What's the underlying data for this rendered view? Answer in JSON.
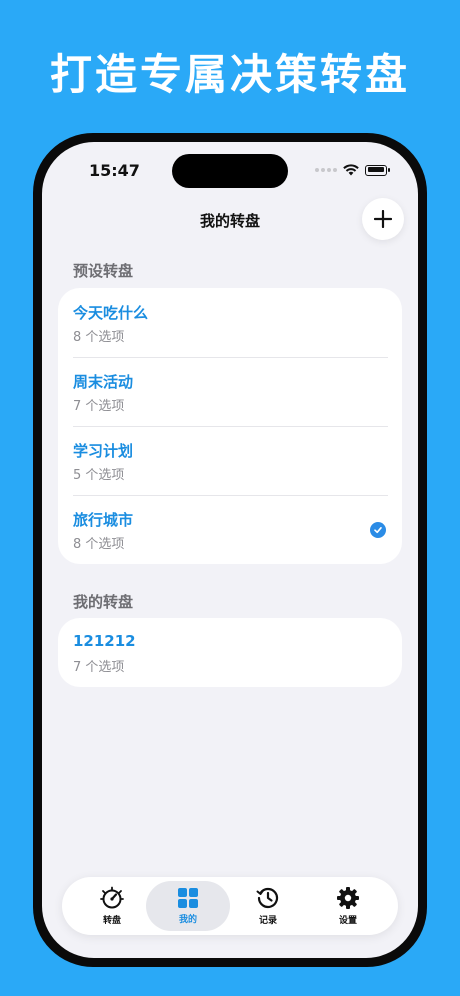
{
  "headline": "打造专属决策转盘",
  "status_bar": {
    "time": "15:47"
  },
  "nav": {
    "title": "我的转盘",
    "add_icon": "plus-icon"
  },
  "preset_section": {
    "title": "预设转盘",
    "items": [
      {
        "name": "今天吃什么",
        "subtitle": "8 个选项",
        "selected": false
      },
      {
        "name": "周末活动",
        "subtitle": "7 个选项",
        "selected": false
      },
      {
        "name": "学习计划",
        "subtitle": "5 个选项",
        "selected": false
      },
      {
        "name": "旅行城市",
        "subtitle": "8 个选项",
        "selected": true
      }
    ]
  },
  "my_section": {
    "title": "我的转盘",
    "items": [
      {
        "name": "121212",
        "subtitle": "7 个选项"
      }
    ]
  },
  "tabbar": {
    "tabs": [
      {
        "label": "转盘",
        "icon": "gauge-icon",
        "active": false
      },
      {
        "label": "我的",
        "icon": "grid-icon",
        "active": true
      },
      {
        "label": "记录",
        "icon": "history-icon",
        "active": false
      },
      {
        "label": "设置",
        "icon": "gear-icon",
        "active": false
      }
    ]
  },
  "colors": {
    "background": "#2aa9f7",
    "accent": "#1a8de0",
    "screen": "#f2f2f7"
  }
}
